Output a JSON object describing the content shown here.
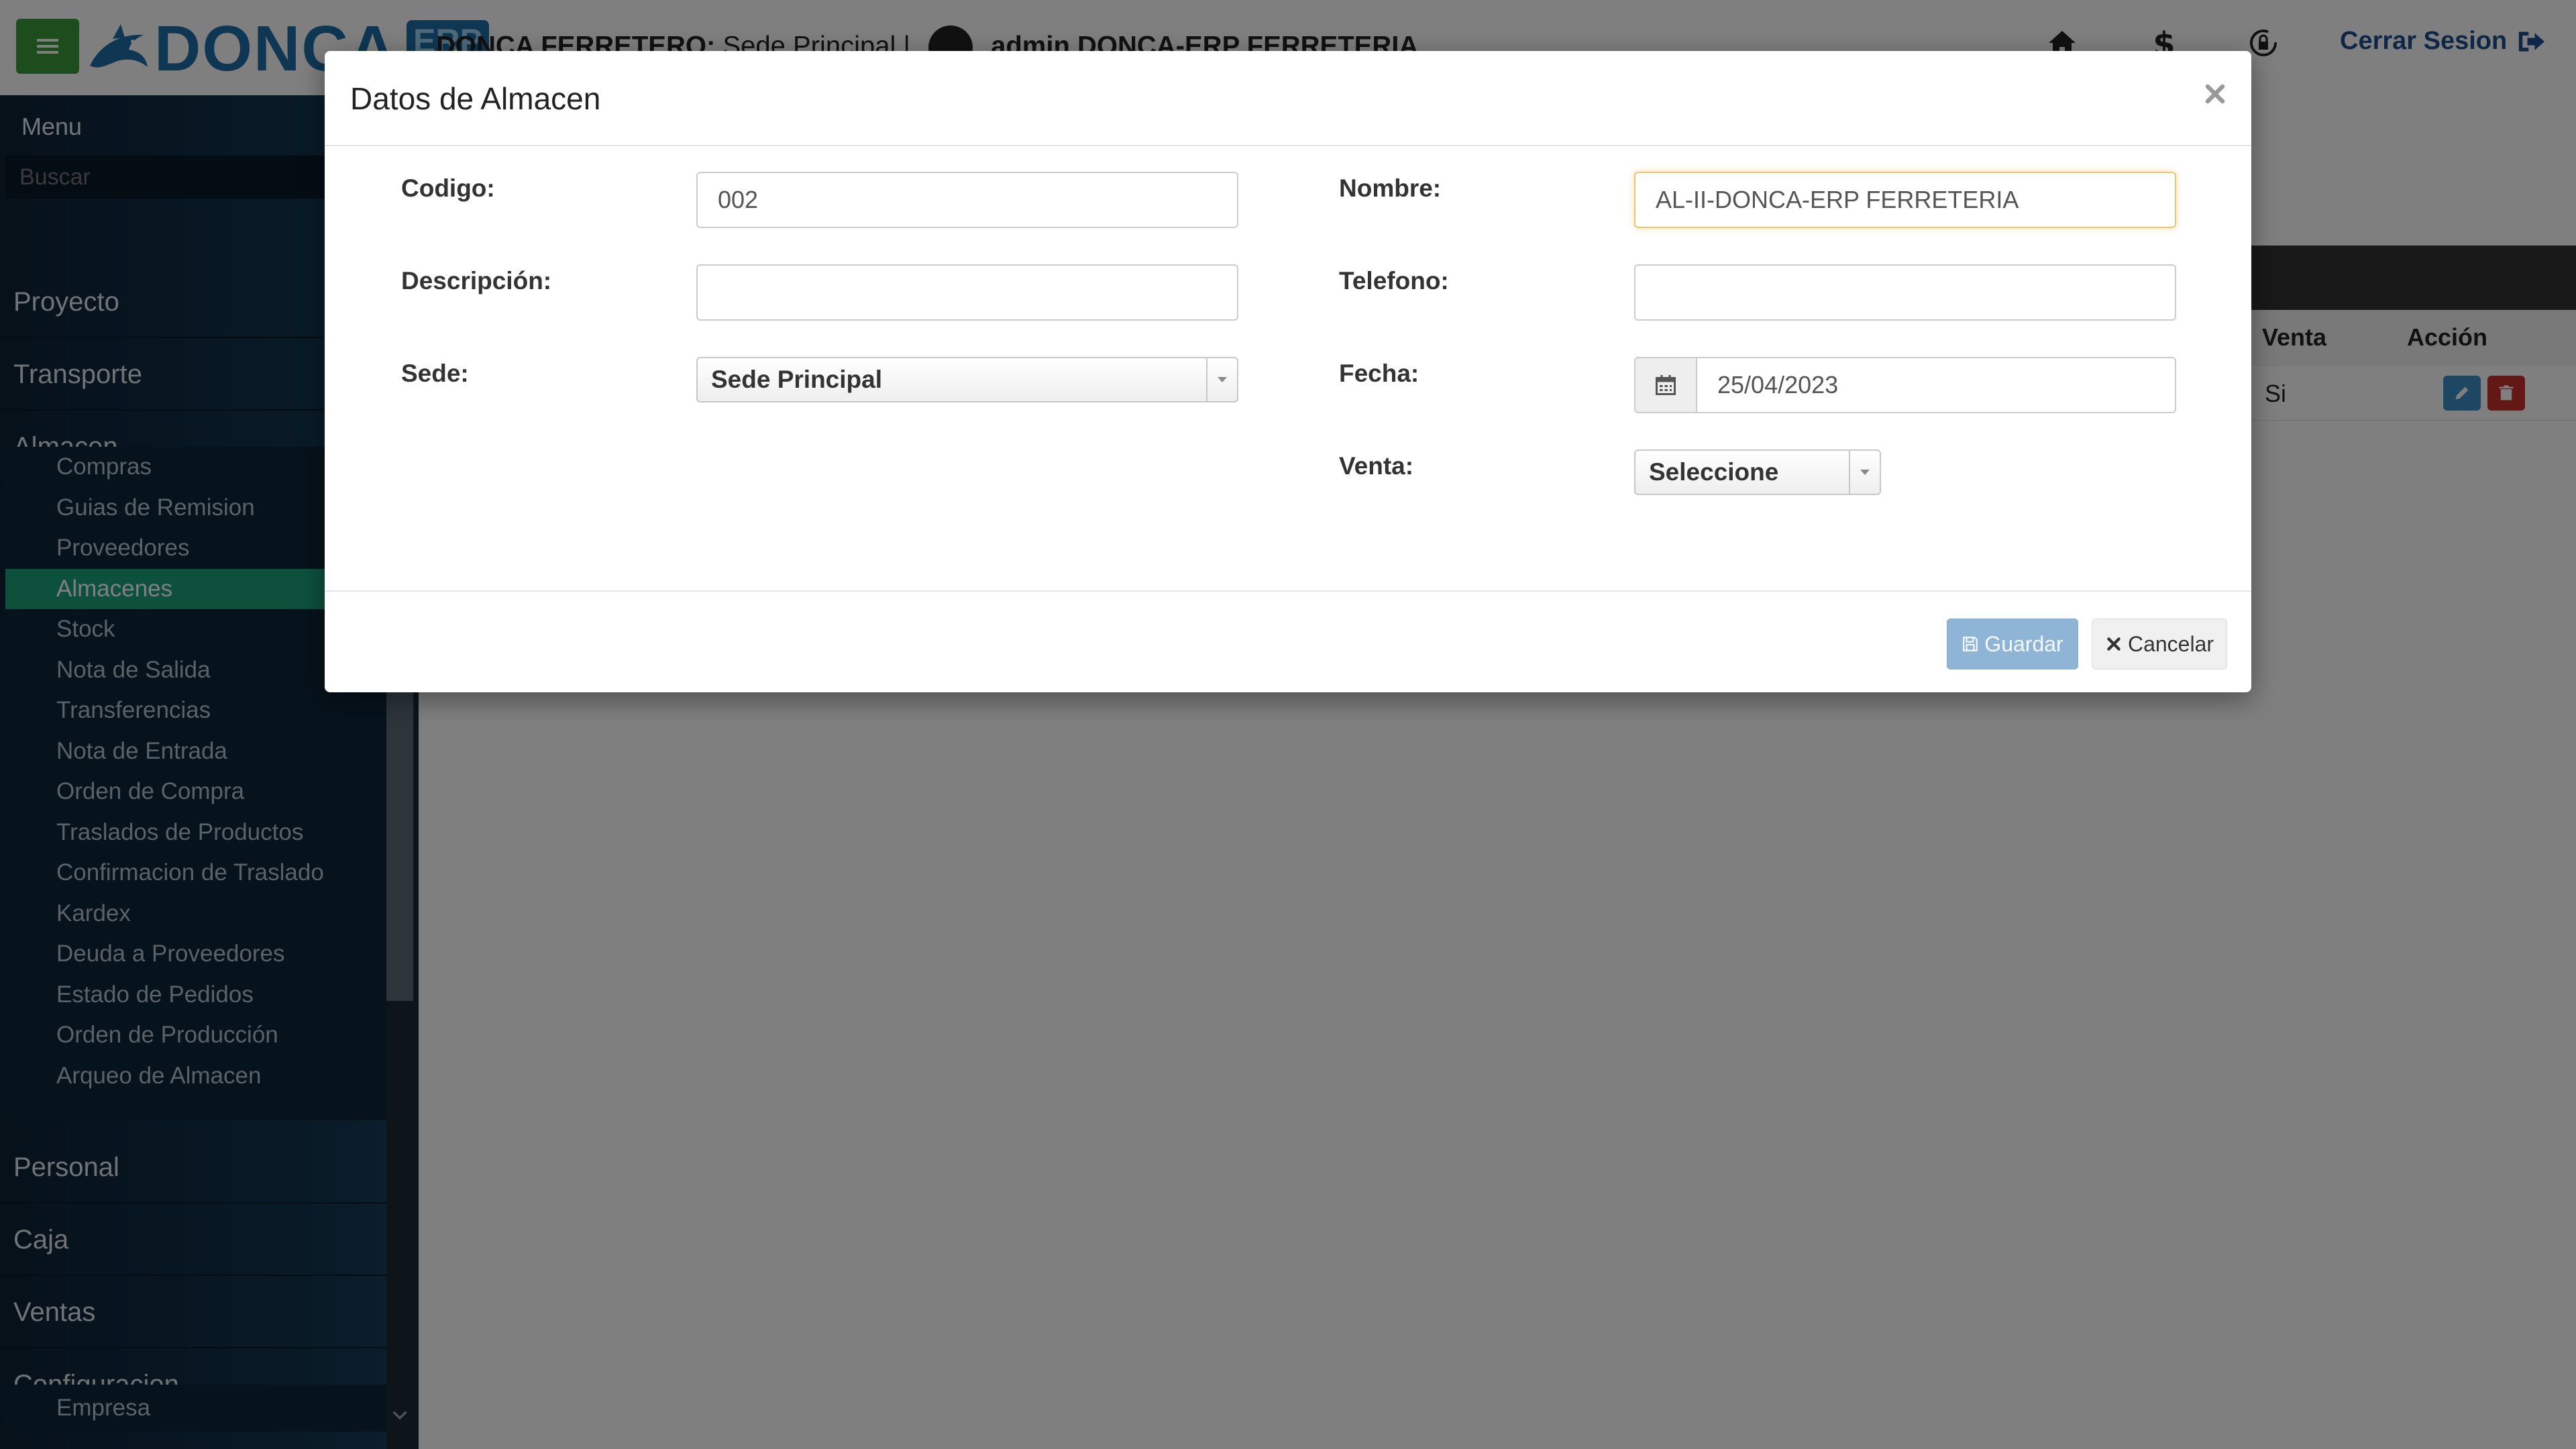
{
  "topbar": {
    "logo_text": "DONCA",
    "logo_badge": "ERP",
    "company": "DONCA FERRETERO:",
    "sede": "Sede Principal |",
    "user": "admin DONCA-ERP FERRETERIA",
    "logout_label": "Cerrar Sesion"
  },
  "sidebar": {
    "menu_title": "Menu",
    "search_placeholder": "Buscar",
    "sections": [
      "Proyecto",
      "Transporte",
      "Almacen",
      "Personal",
      "Caja",
      "Ventas",
      "Configuracion"
    ],
    "almacen_items": [
      "Compras",
      "Guias de Remision",
      "Proveedores",
      "Almacenes",
      "Stock",
      "Nota de Salida",
      "Transferencias",
      "Nota de Entrada",
      "Orden de Compra",
      "Traslados de Productos",
      "Confirmacion de Traslado",
      "Kardex",
      "Deuda a Proveedores",
      "Estado de Pedidos",
      "Orden de Producción",
      "Arqueo de Almacen"
    ],
    "active_item": "Almacenes",
    "config_items": [
      "Empresa"
    ]
  },
  "table": {
    "headers": {
      "venta": "Venta",
      "accion": "Acción"
    },
    "rows": [
      {
        "venta": "Si"
      }
    ]
  },
  "modal": {
    "title": "Datos de Almacen",
    "fields": {
      "codigo": {
        "label": "Codigo:",
        "value": "002"
      },
      "nombre": {
        "label": "Nombre:",
        "value": "AL-II-DONCA-ERP FERRETERIA"
      },
      "descripcion": {
        "label": "Descripción:",
        "value": ""
      },
      "telefono": {
        "label": "Telefono:",
        "value": ""
      },
      "sede": {
        "label": "Sede:",
        "value": "Sede Principal"
      },
      "fecha": {
        "label": "Fecha:",
        "value": "25/04/2023"
      },
      "venta": {
        "label": "Venta:",
        "value": "Seleccione"
      }
    },
    "buttons": {
      "guardar": "Guardar",
      "cancelar": "Cancelar"
    }
  },
  "colors": {
    "accent_green": "#1aa37a",
    "menu_button": "#3c9a3a",
    "brand_blue": "#1f6ea8",
    "logout_blue": "#1f4f8f",
    "edit_button": "#3b8ec6",
    "delete_button": "#c9302c"
  },
  "icons": {
    "menu_toggle": "hamburger-icon",
    "home": "home-icon",
    "money": "dollar-icon",
    "lock": "lock-refresh-icon",
    "logout": "sign-out-icon",
    "calendar": "calendar-icon",
    "save": "floppy-icon",
    "cancel": "times-icon",
    "close": "close-icon",
    "edit": "pencil-icon",
    "delete": "trash-icon"
  }
}
